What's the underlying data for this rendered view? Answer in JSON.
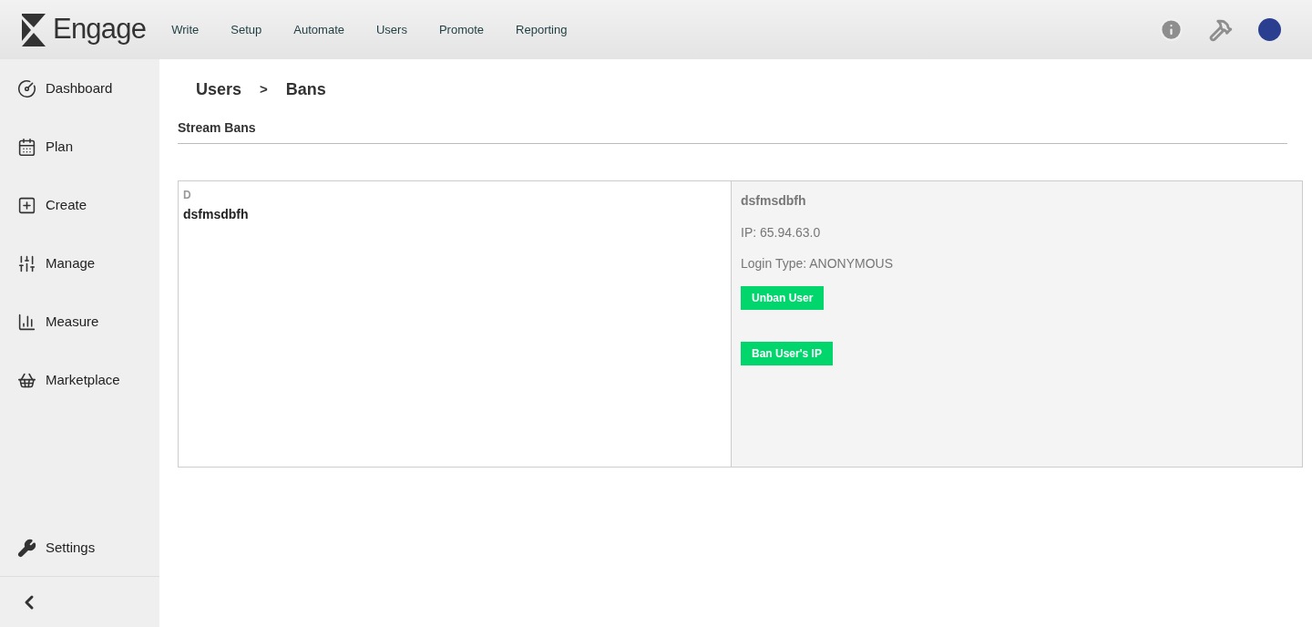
{
  "header": {
    "brand": "Engage",
    "nav": [
      "Write",
      "Setup",
      "Automate",
      "Users",
      "Promote",
      "Reporting"
    ]
  },
  "sidebar": {
    "items": [
      "Dashboard",
      "Plan",
      "Create",
      "Manage",
      "Measure",
      "Marketplace"
    ],
    "settings": "Settings"
  },
  "breadcrumb": {
    "items": [
      "Users",
      "Bans"
    ],
    "separator": ">"
  },
  "section_title": "Stream Bans",
  "list": {
    "group_letter": "D",
    "users": [
      {
        "name": "dsfmsdbfh",
        "selected": true
      }
    ]
  },
  "detail": {
    "name": "dsfmsdbfh",
    "ip": "IP: 65.94.63.0",
    "login_type": "Login Type: ANONYMOUS",
    "buttons": [
      "Unban User",
      "Ban User's IP"
    ]
  }
}
